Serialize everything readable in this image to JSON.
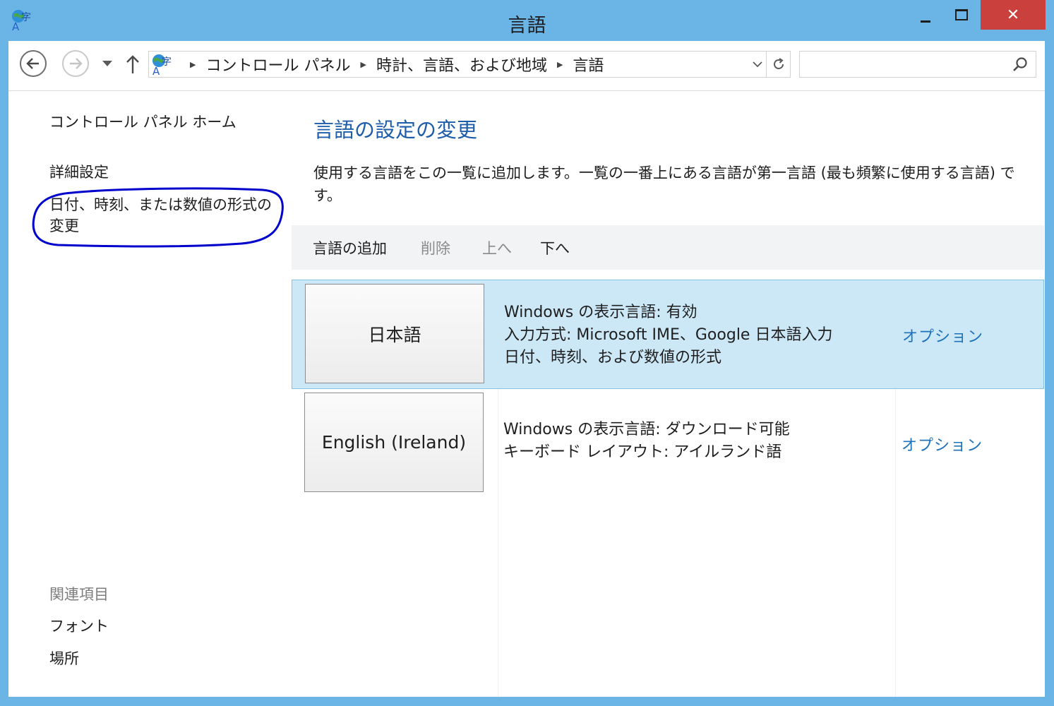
{
  "window": {
    "title": "言語",
    "close_glyph": "✕"
  },
  "address": {
    "crumbs": [
      "コントロール パネル",
      "時計、言語、および地域",
      "言語"
    ],
    "search_placeholder": ""
  },
  "left_nav": {
    "home": "コントロール パネル ホーム",
    "advanced": "詳細設定",
    "datetime_format": "日付、時刻、または数値の形式の変更",
    "related_heading": "関連項目",
    "font": "フォント",
    "location": "場所"
  },
  "main": {
    "title": "言語の設定の変更",
    "description": "使用する言語をこの一覧に追加します。一覧の一番上にある言語が第一言語 (最も頻繁に使用する言語) です。",
    "toolbar": {
      "add": "言語の追加",
      "delete": "削除",
      "up": "上へ",
      "down": "下へ"
    },
    "languages": [
      {
        "name": "日本語",
        "details": [
          "Windows の表示言語: 有効",
          "入力方式: Microsoft IME、Google 日本語入力",
          "日付、時刻、および数値の形式"
        ],
        "options": "オプション",
        "selected": true
      },
      {
        "name": "English (Ireland)",
        "details": [
          "Windows の表示言語: ダウンロード可能",
          "キーボード レイアウト: アイルランド語"
        ],
        "options": "オプション",
        "selected": false
      }
    ]
  },
  "colors": {
    "frame": "#6bb5e6",
    "close_button": "#c9403c",
    "heading_blue": "#1e5daa",
    "link_blue": "#1e72bb",
    "selected_row": "#cce8f6",
    "annotation_ink": "#0000cc"
  },
  "icons": {
    "app": "language-globe-icon",
    "back": "back-arrow-icon",
    "forward": "forward-arrow-icon",
    "up": "up-arrow-icon",
    "refresh": "refresh-icon",
    "search": "search-icon"
  }
}
